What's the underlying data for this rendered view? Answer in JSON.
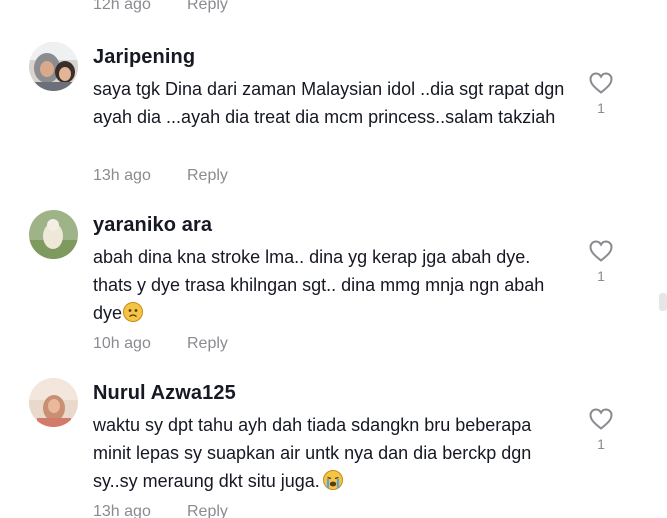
{
  "top_meta": {
    "time": "12h ago",
    "reply": "Reply"
  },
  "comments": [
    {
      "username": "Jaripening",
      "text": "saya tgk Dina dari zaman Malaysian idol ..dia sgt rapat dgn ayah dia ...ayah dia treat dia mcm princess..salam takziah",
      "time": "13h ago",
      "reply": "Reply",
      "likes": "1"
    },
    {
      "username": "yaraniko ara",
      "text": "abah dina kna stroke lma.. dina yg kerap jga abah dye. thats y dye trasa khilngan sgt.. dina mmg mnja ngn abah dye",
      "emoji": "sad-face",
      "time": "10h ago",
      "reply": "Reply",
      "likes": "1"
    },
    {
      "username": "Nurul Azwa125",
      "text": "waktu sy dpt tahu ayh dah tiada sdangkn bru beberapa minit lepas sy suapkan air untk nya dan dia berckp dgn sy..sy meraung dkt situ juga.",
      "emoji": "crying-face",
      "time": "13h ago",
      "reply": "Reply",
      "likes": "1"
    }
  ],
  "colors": {
    "text": "#161823",
    "muted": "#8a8b91",
    "background": "#ffffff"
  }
}
